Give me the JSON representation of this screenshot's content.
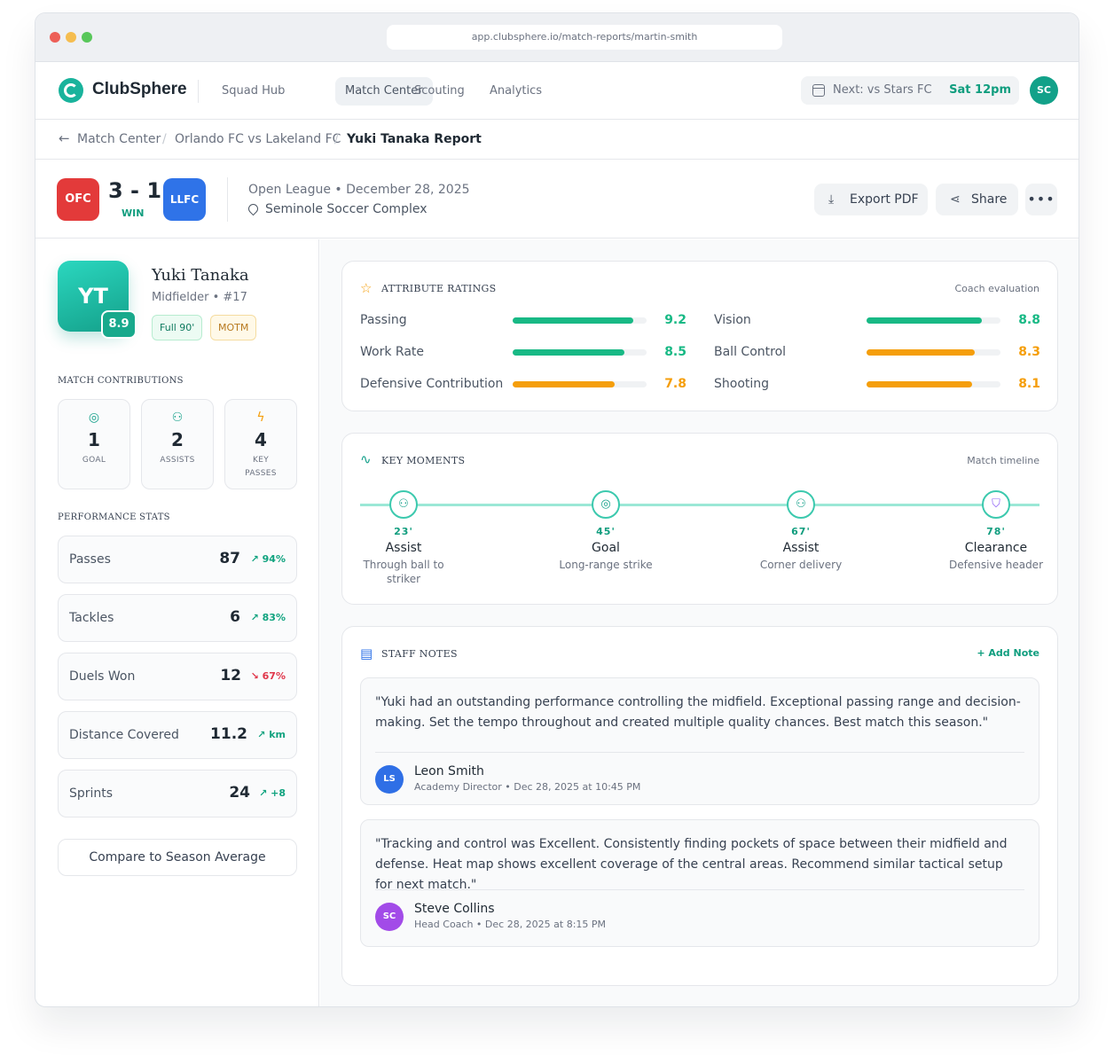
{
  "browser": {
    "url": "app.clubsphere.io/match-reports/martin-smith"
  },
  "nav": {
    "brand": "ClubSphere",
    "links": [
      "Squad Hub",
      "Match Center",
      "Scouting",
      "Analytics"
    ],
    "active": "Match Center",
    "next_label": "Next: vs Stars FC",
    "next_time": "Sat 12pm",
    "user_initials": "SC"
  },
  "breadcrumb": {
    "items": [
      "Match Center",
      "Orlando FC vs Lakeland FC"
    ],
    "current": "Yuki Tanaka Report"
  },
  "match": {
    "home_badge": "OFC",
    "away_badge": "LLFC",
    "score": "3 - 1",
    "result": "WIN",
    "meta": "Open League • December 28, 2025",
    "venue": "Seminole Soccer Complex",
    "actions": {
      "export": "Export PDF",
      "share": "Share",
      "more": "•••"
    }
  },
  "player": {
    "initials": "YT",
    "rating": "8.9",
    "name": "Yuki Tanaka",
    "position": "Midfielder • #17",
    "tags": [
      "Full 90'",
      "MOTM"
    ]
  },
  "contributions": {
    "title": "MATCH CONTRIBUTIONS",
    "items": [
      {
        "icon": "target-icon",
        "value": "1",
        "label": "GOAL"
      },
      {
        "icon": "users-icon",
        "value": "2",
        "label": "ASSISTS"
      },
      {
        "icon": "bolt-icon",
        "value": "4",
        "label": "KEY PASSES"
      }
    ]
  },
  "performance": {
    "title": "PERFORMANCE STATS",
    "stats": [
      {
        "label": "Passes",
        "value": "87",
        "trend": "94%",
        "direction": "up"
      },
      {
        "label": "Tackles",
        "value": "6",
        "trend": "83%",
        "direction": "up"
      },
      {
        "label": "Duels Won",
        "value": "12",
        "trend": "67%",
        "direction": "down"
      },
      {
        "label": "Distance Covered",
        "value": "11.2",
        "trend": "km",
        "direction": "up"
      },
      {
        "label": "Sprints",
        "value": "24",
        "trend": "+8",
        "direction": "up"
      }
    ],
    "compare_button": "Compare to Season Average"
  },
  "attributes": {
    "title": "ATTRIBUTE RATINGS",
    "subtitle": "Coach evaluation",
    "items": [
      {
        "label": "Passing",
        "value": "9.2",
        "color": "#18b985"
      },
      {
        "label": "Vision",
        "value": "8.8",
        "color": "#18b985"
      },
      {
        "label": "Work Rate",
        "value": "8.5",
        "color": "#18b985"
      },
      {
        "label": "Ball Control",
        "value": "8.3",
        "color": "#f59e0b"
      },
      {
        "label": "Defensive Contribution",
        "value": "7.8",
        "color": "#f59e0b"
      },
      {
        "label": "Shooting",
        "value": "8.1",
        "color": "#f59e0b"
      }
    ]
  },
  "moments": {
    "title": "KEY MOMENTS",
    "subtitle": "Match timeline",
    "items": [
      {
        "icon": "users-icon",
        "time": "23'",
        "type": "Assist",
        "desc": "Through ball to striker"
      },
      {
        "icon": "target-icon",
        "time": "45'",
        "type": "Goal",
        "desc": "Long-range strike"
      },
      {
        "icon": "users-icon",
        "time": "67'",
        "type": "Assist",
        "desc": "Corner delivery"
      },
      {
        "icon": "shield-icon",
        "time": "78'",
        "type": "Clearance",
        "desc": "Defensive header"
      }
    ]
  },
  "notes": {
    "title": "STAFF NOTES",
    "add_label": "+ Add Note",
    "items": [
      {
        "text": "\"Yuki had an outstanding performance controlling the midfield. Exceptional passing range and decision-making. Set the tempo throughout and created multiple quality chances. Best match this season.\"",
        "initials": "LS",
        "author": "Leon Smith",
        "meta": "Academy Director • Dec 28, 2025 at 10:45 PM",
        "color": "#2f6fe6"
      },
      {
        "text": "\"Tracking and control was Excellent.  Consistently finding pockets of space between their midfield and defense. Heat map shows excellent coverage of the central areas. Recommend similar tactical setup for next match.\"",
        "initials": "SC",
        "author": "Steve Collins",
        "meta": "Head Coach • Dec 28, 2025 at 8:15 PM",
        "color": "#a24be8"
      }
    ]
  }
}
